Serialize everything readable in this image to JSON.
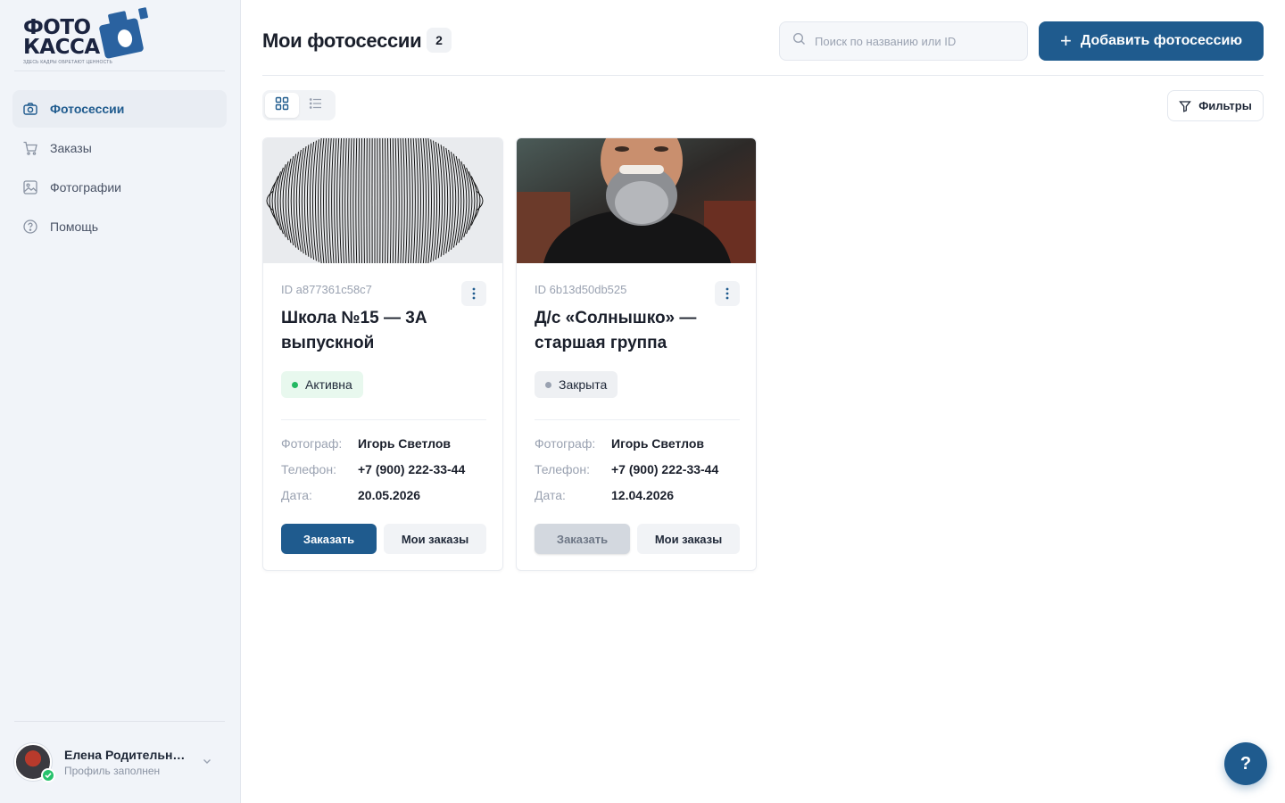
{
  "brand": {
    "logo_line1": "ФОТО",
    "logo_line2": "КАССА",
    "tagline": "ЗДЕСЬ КАДРЫ ОБРЕТАЮТ ЦЕННОСТЬ",
    "accent": "#1f5b8e"
  },
  "sidebar": {
    "items": [
      {
        "label": "Фотосессии",
        "icon": "camera-icon",
        "active": true
      },
      {
        "label": "Заказы",
        "icon": "cart-icon",
        "active": false
      },
      {
        "label": "Фотографии",
        "icon": "image-icon",
        "active": false
      },
      {
        "label": "Помощь",
        "icon": "help-circle-icon",
        "active": false
      }
    ],
    "profile": {
      "name": "Елена Родительница",
      "status": "Профиль заполнен"
    }
  },
  "header": {
    "title": "Мои фотосессии",
    "count": "2",
    "search_placeholder": "Поиск по названию или ID",
    "add_button": "Добавить фотосессию"
  },
  "toolbar": {
    "view_mode": "grid",
    "filters_label": "Фильтры"
  },
  "sessions": [
    {
      "id": "ID a877361c58c7",
      "title": "Школа №15 — 3А выпускной",
      "status": "Активна",
      "status_kind": "active",
      "photographer_label": "Фотограф:",
      "photographer": "Игорь Светлов",
      "phone_label": "Телефон:",
      "phone": "+7 (900) 222-33-44",
      "date_label": "Дата:",
      "date": "20.05.2026",
      "order_label": "Заказать",
      "orders_label": "Мои заказы",
      "order_enabled": true
    },
    {
      "id": "ID 6b13d50db525",
      "title": "Д/с «Солнышко» — старшая группа",
      "status": "Закрыта",
      "status_kind": "closed",
      "photographer_label": "Фотограф:",
      "photographer": "Игорь Светлов",
      "phone_label": "Телефон:",
      "phone": "+7 (900) 222-33-44",
      "date_label": "Дата:",
      "date": "12.04.2026",
      "order_label": "Заказать",
      "orders_label": "Мои заказы",
      "order_enabled": false
    }
  ],
  "help_fab": "?"
}
